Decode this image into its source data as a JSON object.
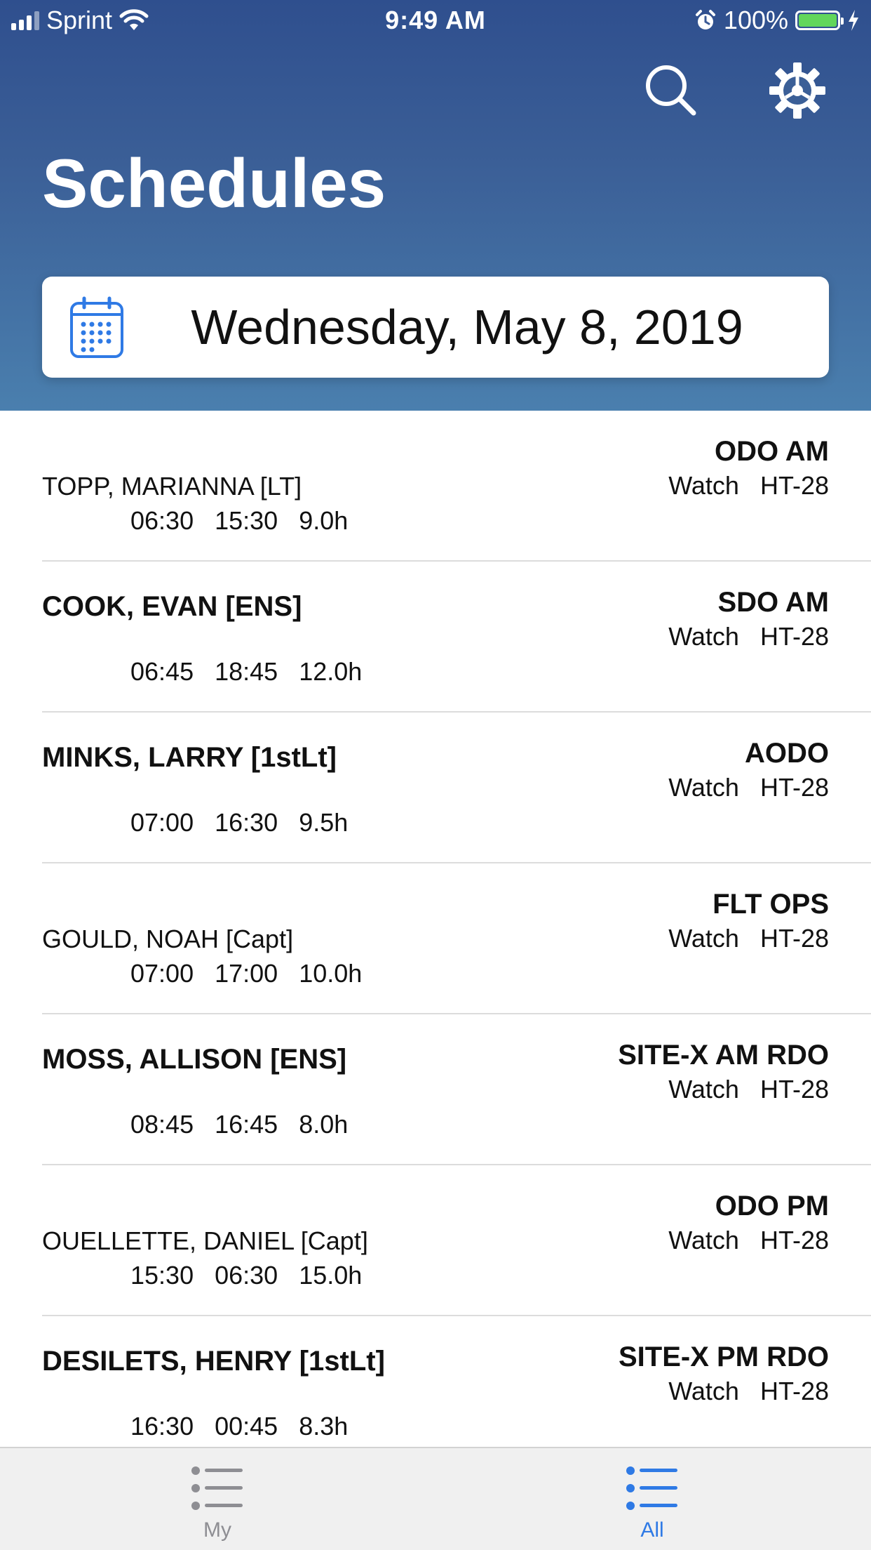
{
  "status_bar": {
    "carrier": "Sprint",
    "time": "9:49 AM",
    "battery_percent": "100%",
    "battery_level": 1.0
  },
  "header": {
    "title": "Schedules",
    "search_icon": "search-icon",
    "settings_icon": "gear-icon"
  },
  "date_picker": {
    "icon": "calendar-icon",
    "date": "Wednesday, May 8, 2019"
  },
  "schedule": [
    {
      "name": "TOPP, MARIANNA [LT]",
      "bold": false,
      "position": "ODO AM",
      "type": "Watch",
      "location": "HT-28",
      "start": "06:30",
      "end": "15:30",
      "hours": "9.0h"
    },
    {
      "name": "COOK, EVAN [ENS]",
      "bold": true,
      "position": "SDO AM",
      "type": "Watch",
      "location": "HT-28",
      "start": "06:45",
      "end": "18:45",
      "hours": "12.0h"
    },
    {
      "name": "MINKS, LARRY [1stLt]",
      "bold": true,
      "position": "AODO",
      "type": "Watch",
      "location": "HT-28",
      "start": "07:00",
      "end": "16:30",
      "hours": "9.5h"
    },
    {
      "name": "GOULD, NOAH [Capt]",
      "bold": false,
      "position": "FLT OPS",
      "type": "Watch",
      "location": "HT-28",
      "start": "07:00",
      "end": "17:00",
      "hours": "10.0h"
    },
    {
      "name": "MOSS, ALLISON [ENS]",
      "bold": true,
      "position": "SITE-X AM RDO",
      "type": "Watch",
      "location": "HT-28",
      "start": "08:45",
      "end": "16:45",
      "hours": "8.0h"
    },
    {
      "name": "OUELLETTE, DANIEL [Capt]",
      "bold": false,
      "position": "ODO PM",
      "type": "Watch",
      "location": "HT-28",
      "start": "15:30",
      "end": "06:30",
      "hours": "15.0h"
    },
    {
      "name": "DESILETS, HENRY [1stLt]",
      "bold": true,
      "position": "SITE-X PM RDO",
      "type": "Watch",
      "location": "HT-28",
      "start": "16:30",
      "end": "00:45",
      "hours": "8.3h"
    }
  ],
  "tabbar": {
    "tabs": [
      {
        "label": "My",
        "icon": "list-icon",
        "active": false
      },
      {
        "label": "All",
        "icon": "list-icon",
        "active": true
      }
    ]
  },
  "colors": {
    "header_top": "#2f4f8e",
    "header_bottom": "#4a7fae",
    "accent": "#2f7ae5",
    "inactive": "#8e8e93",
    "battery": "#62d65b"
  }
}
